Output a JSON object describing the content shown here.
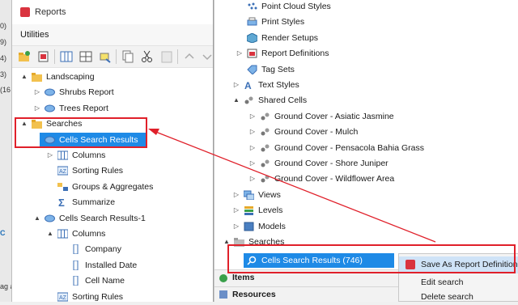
{
  "background_fragments": [
    "0)",
    "9)",
    "4)",
    "3)",
    "(16",
    "C",
    "ag a"
  ],
  "window": {
    "title": "Reports",
    "menu": "Utilities"
  },
  "left_tree": [
    {
      "label": "Landscaping",
      "icon": "folder-icon",
      "arrow": "▲"
    },
    {
      "label": "Shrubs Report",
      "icon": "report-icon",
      "arrow": "▷"
    },
    {
      "label": "Trees Report",
      "icon": "report-icon",
      "arrow": "▷"
    },
    {
      "label": "Searches",
      "icon": "folder-icon",
      "arrow": "▲"
    },
    {
      "label": "Cells Search Results",
      "icon": "report-icon",
      "arrow": "▲",
      "selected": true
    },
    {
      "label": "Columns",
      "icon": "columns-icon",
      "arrow": "▷"
    },
    {
      "label": "Sorting Rules",
      "icon": "sort-icon",
      "arrow": ""
    },
    {
      "label": "Groups & Aggregates",
      "icon": "group-icon",
      "arrow": ""
    },
    {
      "label": "Summarize",
      "icon": "sum-icon",
      "arrow": ""
    },
    {
      "label": "Cells Search Results-1",
      "icon": "report-icon",
      "arrow": "▲"
    },
    {
      "label": "Columns",
      "icon": "columns-icon",
      "arrow": "▲"
    },
    {
      "label": "Company",
      "icon": "column-icon",
      "arrow": ""
    },
    {
      "label": "Installed Date",
      "icon": "column-icon",
      "arrow": ""
    },
    {
      "label": "Cell Name",
      "icon": "column-icon",
      "arrow": ""
    },
    {
      "label": "Sorting Rules",
      "icon": "sort-icon",
      "arrow": ""
    }
  ],
  "right_tree": [
    {
      "label": "Point Cloud Styles",
      "icon": "pointcloud-icon",
      "arrow": ""
    },
    {
      "label": "Print Styles",
      "icon": "print-icon",
      "arrow": ""
    },
    {
      "label": "Render Setups",
      "icon": "render-icon",
      "arrow": ""
    },
    {
      "label": "Report Definitions",
      "icon": "report-def-icon",
      "arrow": "▷"
    },
    {
      "label": "Tag Sets",
      "icon": "tag-icon",
      "arrow": ""
    },
    {
      "label": "Text Styles",
      "icon": "text-icon",
      "arrow": "▷"
    },
    {
      "label": "Shared Cells",
      "icon": "cell-icon",
      "arrow": "▲"
    },
    {
      "label": "Ground Cover -  Asiatic Jasmine",
      "icon": "cell-icon",
      "arrow": "▷"
    },
    {
      "label": "Ground Cover - Mulch",
      "icon": "cell-icon",
      "arrow": "▷"
    },
    {
      "label": "Ground Cover - Pensacola Bahia Grass",
      "icon": "cell-icon",
      "arrow": "▷"
    },
    {
      "label": "Ground Cover - Shore Juniper",
      "icon": "cell-icon",
      "arrow": "▷"
    },
    {
      "label": "Ground Cover - Wildflower Area",
      "icon": "cell-icon",
      "arrow": "▷"
    },
    {
      "label": "Views",
      "icon": "views-icon",
      "arrow": "▷"
    },
    {
      "label": "Levels",
      "icon": "levels-icon",
      "arrow": "▷"
    },
    {
      "label": "Models",
      "icon": "models-icon",
      "arrow": "▷"
    },
    {
      "label": "Searches",
      "icon": "search-folder-icon",
      "arrow": "▲"
    },
    {
      "label": "Cells Search Results (746)",
      "icon": "search-icon",
      "arrow": "▷",
      "selected": true
    }
  ],
  "bottom_sections": [
    "Items",
    "Resources"
  ],
  "context_menu": [
    "Save As Report Definition",
    "Edit search",
    "Delete search"
  ],
  "colors": {
    "selection": "#1e8ae6",
    "annotation": "#e0202a",
    "folder": "#f2c14e"
  }
}
